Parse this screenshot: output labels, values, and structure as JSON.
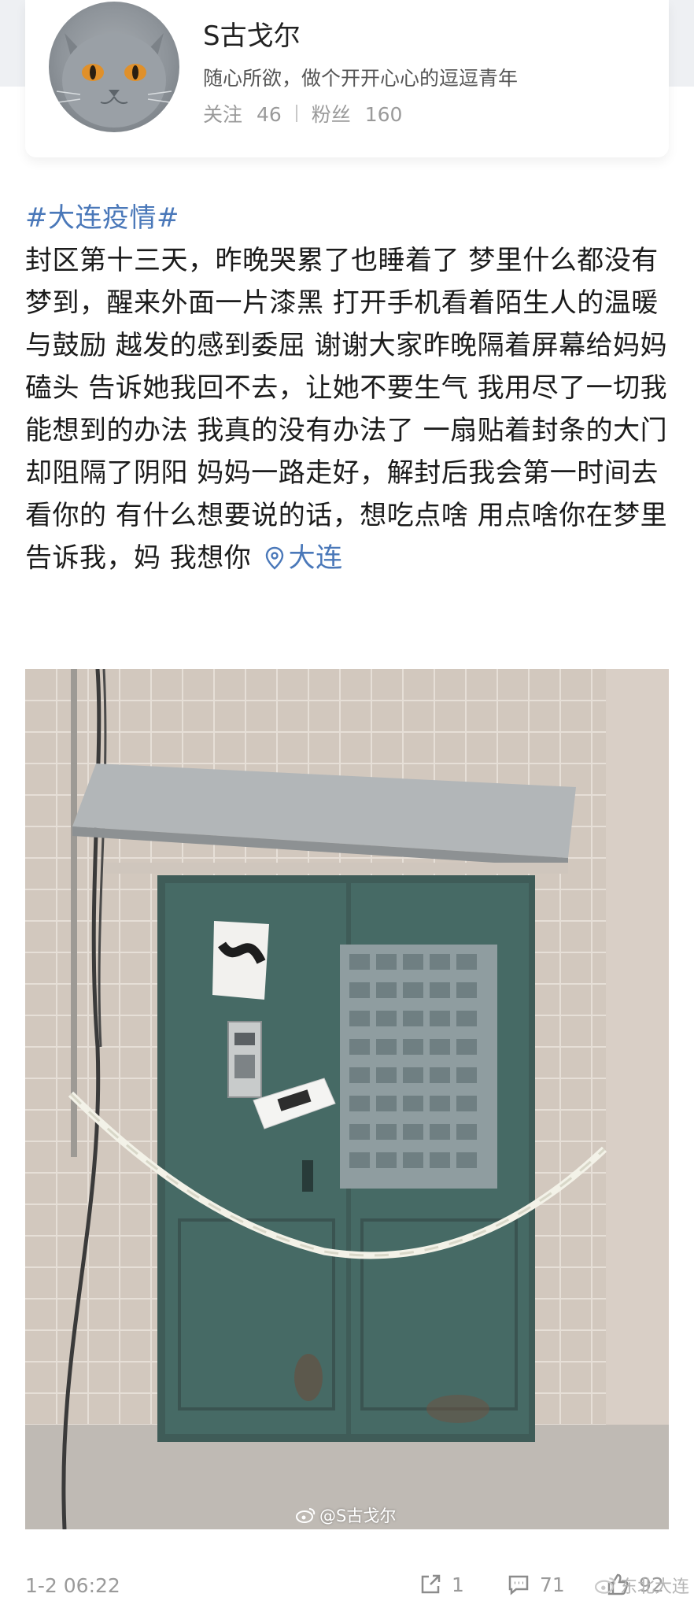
{
  "profile": {
    "username": "S古戈尔",
    "bio": "随心所欲，做个开开心心的逗逗青年",
    "following_label": "关注",
    "following_count": "46",
    "followers_label": "粉丝",
    "followers_count": "160"
  },
  "post": {
    "hashtag": "#大连疫情#",
    "body": "封区第十三天，昨晚哭累了也睡着了 梦里什么都没有梦到，醒来外面一片漆黑 打开手机看着陌生人的温暖与鼓励 越发的感到委屈 谢谢大家昨晚隔着屏幕给妈妈磕头 告诉她我回不去，让她不要生气 我用尽了一切我能想到的办法 我真的没有办法了 一扇贴着封条的大门却阻隔了阴阳 妈妈一路走好，解封后我会第一时间去看你的 有什么想要说的话，想吃点啥 用点啥你在梦里告诉我，妈 我想你",
    "location": "大连",
    "image_watermark": "@S古戈尔"
  },
  "footer": {
    "timestamp": "1-2 06:22",
    "reposts": "1",
    "comments": "71",
    "likes": "92",
    "source": "东北大连"
  },
  "colors": {
    "link": "#4a78b9",
    "meta_gray": "#9a9a9a"
  },
  "icons": [
    "location-pin-icon",
    "repost-icon",
    "comment-icon",
    "like-icon",
    "weibo-logo-icon"
  ]
}
